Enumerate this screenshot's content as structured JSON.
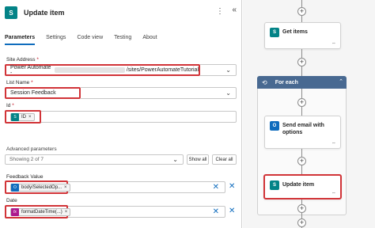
{
  "panel": {
    "title": "Update item",
    "icon_text": "S",
    "more_icon": "⋮",
    "collapse_icon": "«",
    "tabs": [
      {
        "label": "Parameters"
      },
      {
        "label": "Settings"
      },
      {
        "label": "Code view"
      },
      {
        "label": "Testing"
      },
      {
        "label": "About"
      }
    ],
    "site_address": {
      "label": "Site Address",
      "required": "*",
      "value_prefix": "Power Automate -",
      "value_suffix": "/sites/PowerAutomateTutorial"
    },
    "list_name": {
      "label": "List Name",
      "required": "*",
      "value": "Session Feedback"
    },
    "id_field": {
      "label": "Id",
      "required": "*",
      "token": "ID"
    },
    "advanced": {
      "label": "Advanced parameters",
      "select_value": "Showing 2 of 7",
      "show_all": "Show all",
      "clear_all": "Clear all"
    },
    "feedback_value": {
      "label": "Feedback Value",
      "token": "body/SelectedOp..."
    },
    "date": {
      "label": "Date",
      "token": "formatDateTime(...)"
    },
    "token_close": "×",
    "clear_icon": "✕",
    "dropdown_icon": "⌄"
  },
  "flow": {
    "cards": [
      {
        "title": "Get items",
        "icon": "S"
      },
      {
        "title": "For each",
        "icon": "⟲"
      },
      {
        "title": "Send email with options",
        "icon": "O"
      },
      {
        "title": "Update item",
        "icon": "S"
      }
    ],
    "plus_icon": "+",
    "link_icon": "⇔",
    "chevron": "⌃"
  },
  "colors": {
    "accent": "#0f6cbd",
    "sharepoint": "#038387",
    "highlight": "#d13438",
    "foreach": "#486991"
  }
}
